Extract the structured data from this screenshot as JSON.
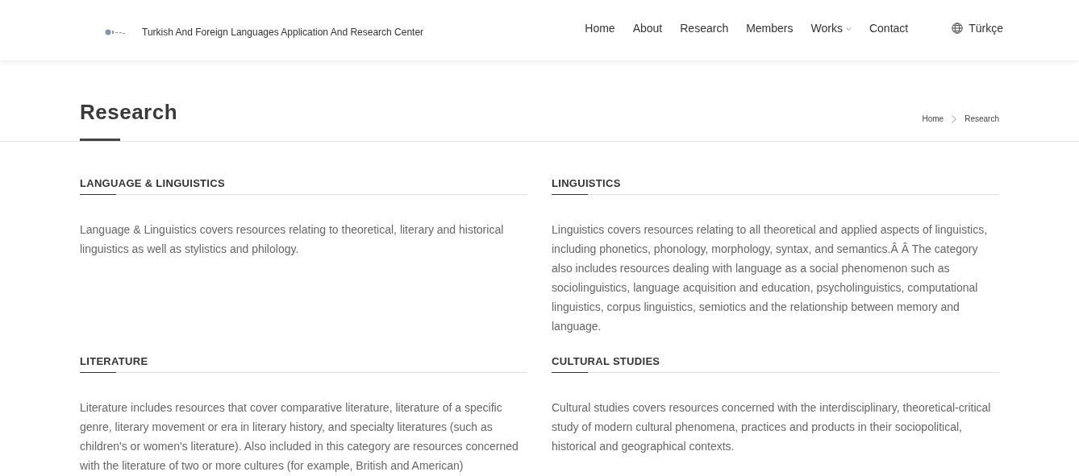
{
  "header": {
    "site_title": "Turkish And Foreign Languages Application And Research Center",
    "nav": [
      {
        "label": "Home",
        "has_dropdown": false
      },
      {
        "label": "About",
        "has_dropdown": false
      },
      {
        "label": "Research",
        "has_dropdown": false
      },
      {
        "label": "Members",
        "has_dropdown": false
      },
      {
        "label": "Works",
        "has_dropdown": true
      },
      {
        "label": "Contact",
        "has_dropdown": false
      }
    ],
    "language": "Türkçe"
  },
  "page_title": "Research",
  "breadcrumb": [
    "Home",
    "Research"
  ],
  "sections": [
    {
      "heading": "LANGUAGE & LINGUISTICS",
      "text": "Language & Linguistics covers resources relating to theoretical, literary and historical linguistics as well as stylistics and philology."
    },
    {
      "heading": "LINGUISTICS",
      "text": "Linguistics covers resources relating to all theoretical and applied aspects of linguistics, including phonetics, phonology, morphology, syntax, and semantics.Â Â  The category also includes resources dealing with language as a social phenomenon such as sociolinguistics, language acquisition and education, psycholinguistics, computational linguistics, corpus linguistics, semiotics and the relationship between memory and language."
    },
    {
      "heading": "LITERATURE",
      "text": "Literature includes resources that cover comparative literature, literature of a specific genre, literary movement or era in literary history, and specialty literatures (such as children's or women's literature). Also included in this category are resources concerned with the literature of two or more cultures (for example, British and American)"
    },
    {
      "heading": "CULTURAL STUDIES",
      "text": "Cultural studies covers resources concerned with the interdisciplinary, theoretical-critical study of modern cultural phenomena, practices and products in their sociopolitical, historical and geographical contexts."
    }
  ]
}
